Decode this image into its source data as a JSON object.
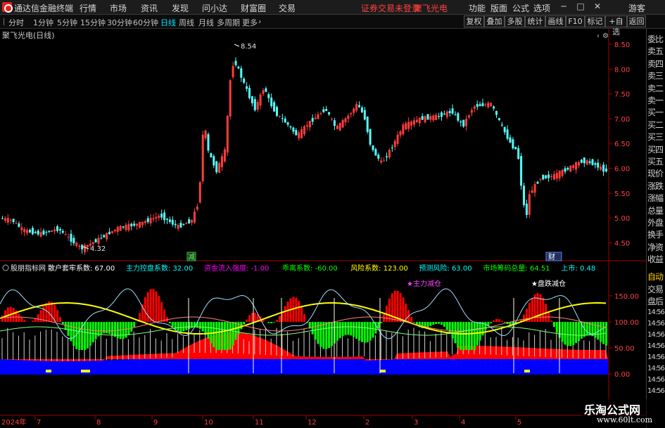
{
  "menubar": {
    "app_name": "通达信金融终端",
    "items": [
      "行情",
      "市场",
      "资讯",
      "发现",
      "问小达",
      "财富圈",
      "交易"
    ],
    "broker_status": "证券交易未登录",
    "stock_name": "聚飞光电",
    "right_items": [
      "功能",
      "版面",
      "公式",
      "选项"
    ],
    "user": "游客",
    "min_icon": "minimize-icon",
    "max_icon": "maximize-icon",
    "close_icon": "close-icon"
  },
  "toolbar": {
    "periods": [
      "分时",
      "1分钟",
      "5分钟",
      "15分钟",
      "30分钟",
      "60分钟",
      "日线",
      "周线",
      "月线",
      "多周期",
      "更多"
    ],
    "active_period": "日线",
    "more_icon": "chevron-right-icon",
    "right_buttons": [
      "复权",
      "叠加",
      "多股",
      "统计",
      "画线",
      "F10",
      "标记",
      "+自选",
      "返回"
    ]
  },
  "chart": {
    "title": "聚飞光电(日线)",
    "high_label": "8.54",
    "low_label": "4.32",
    "price_ticks": [
      "8.50",
      "8.00",
      "7.50",
      "7.00",
      "6.50",
      "6.00",
      "5.50",
      "5.00",
      "4.50"
    ],
    "event_markers": [
      "减",
      "财"
    ],
    "colors": {
      "up": "#ff3c3c",
      "down": "#54ffff",
      "yellow": "#ffff00",
      "green": "#00ff00",
      "blue": "#0000ff",
      "red": "#ff0000"
    }
  },
  "indicator": {
    "name": "股朋指标网",
    "params": [
      {
        "label": "散户套牢系数:",
        "value": "67.00",
        "color": "#ffffff"
      },
      {
        "label": "主力控盘系数:",
        "value": "32.00",
        "color": "#00ffff"
      },
      {
        "label": "资金流入强度:",
        "value": "-1.00",
        "color": "#ff00ff"
      },
      {
        "label": "乖离系数:",
        "value": "-60.00",
        "color": "#00ff00"
      },
      {
        "label": "风险系数:",
        "value": "123.00",
        "color": "#ffff00"
      },
      {
        "label": "预测风险:",
        "value": "63.00",
        "color": "#00ffff"
      },
      {
        "label": "市场筹码总量:",
        "value": "64.51",
        "color": "#00ff00"
      },
      {
        "label": "上市:",
        "value": "0.48",
        "color": "#00ffff"
      }
    ],
    "annotations": [
      "★主力减仓",
      "★盘跌减仓"
    ],
    "ticks": [
      "150.00",
      "100.00",
      "50.00",
      "0.00"
    ]
  },
  "xaxis": {
    "labels": [
      "2024年",
      "7",
      "8",
      "9",
      "10",
      "11",
      "12",
      "2",
      "3",
      "4",
      "5"
    ]
  },
  "sidepanel": {
    "labels": [
      "委比",
      "卖五",
      "卖四",
      "卖三",
      "卖二",
      "卖一",
      "买一",
      "买二",
      "买三",
      "买四",
      "买五",
      "现价",
      "涨跌",
      "涨幅",
      "总量",
      "外盘",
      "换手",
      "净资",
      "收益"
    ],
    "auto_label": "自动",
    "lower_labels": [
      "交易",
      "盘后"
    ],
    "times": [
      "14:56",
      "14:56",
      "14:56",
      "14:56",
      "14:56",
      "14:56",
      "14:56",
      "14:56"
    ]
  },
  "watermark": {
    "site_name": "乐淘公式网",
    "site_url": "www.60lt.com"
  }
}
